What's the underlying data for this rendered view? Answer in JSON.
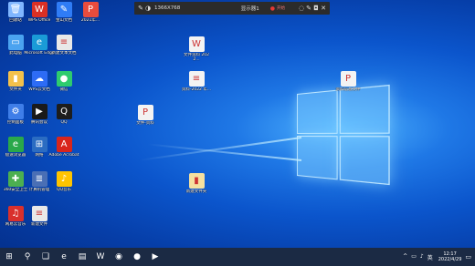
{
  "toolbar": {
    "resolution": "1366X768",
    "display": "显示器1",
    "record": "开始"
  },
  "desktop_icons": [
    {
      "label": "回收站",
      "color": "#7fb6ff",
      "glyph": "🗑"
    },
    {
      "label": "WPS Office",
      "color": "#d93025",
      "glyph": "W"
    },
    {
      "label": "金山文档",
      "color": "#2f7cf6",
      "glyph": "✎"
    },
    {
      "label": "2021年...",
      "color": "#e84c3d",
      "glyph": "P"
    },
    {
      "label": "此电脑",
      "color": "#4aa3f0",
      "glyph": "▭"
    },
    {
      "label": "Microsoft Edge",
      "color": "#1a9bd7",
      "glyph": "e"
    },
    {
      "label": "新建文本文档",
      "color": "#e8e8e8",
      "glyph": "≡"
    },
    {
      "label": "文件夹",
      "color": "#f3c14b",
      "glyph": "▮"
    },
    {
      "label": "WPS云文档",
      "color": "#2d6cf5",
      "glyph": "☁"
    },
    {
      "label": "微信",
      "color": "#2ecb6e",
      "glyph": "●"
    },
    {
      "label": "控制面板",
      "color": "#3f7ee8",
      "glyph": "⚙"
    },
    {
      "label": "腾讯会议",
      "color": "#1a1a1a",
      "glyph": "▶"
    },
    {
      "label": "QQ",
      "color": "#1d1d1d",
      "glyph": "Q"
    },
    {
      "label": "极速浏览器",
      "color": "#2aa84a",
      "glyph": "e"
    },
    {
      "label": "网络",
      "color": "#2b6cc2",
      "glyph": "⊞"
    },
    {
      "label": "Adobe Acrobat",
      "color": "#d9251c",
      "glyph": "A"
    },
    {
      "label": "360安全卫士",
      "color": "#4caf50",
      "glyph": "✚"
    },
    {
      "label": "计算机管理",
      "color": "#4a6fb5",
      "glyph": "≣"
    },
    {
      "label": "QQ音乐",
      "color": "#ffc400",
      "glyph": "♪"
    },
    {
      "label": "网易云音乐",
      "color": "#d9302c",
      "glyph": "♫"
    },
    {
      "label": "新建文件",
      "color": "#e8e8e8",
      "glyph": "≡"
    }
  ],
  "file_icons": [
    {
      "label": "文件资料 2022...",
      "color": "#f3f3f3",
      "glyph": "W"
    },
    {
      "label": "资料-2022 年...",
      "color": "#f3f3f3",
      "glyph": "≡"
    },
    {
      "label": "文件-资料",
      "color": "#f3f3f3",
      "glyph": "P"
    },
    {
      "label": "新建文件夹",
      "color": "#f4e0a0",
      "glyph": "▮"
    },
    {
      "label": "资料信息文件",
      "color": "#f3f3f3",
      "glyph": "P"
    }
  ],
  "taskbar": {
    "items": [
      "⊞",
      "⚲",
      "❑",
      "e",
      "▤",
      "W",
      "◉",
      "●",
      "▶"
    ],
    "tray": [
      "^",
      "▭",
      "♪",
      "英"
    ],
    "time": "12:17",
    "date": "2022/4/29"
  }
}
